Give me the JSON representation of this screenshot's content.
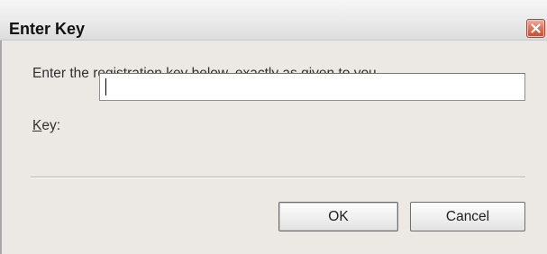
{
  "window": {
    "title": "Enter Key",
    "close_icon": "close-icon"
  },
  "dialog": {
    "prompt": "Enter the registration key below, exactly as given to you.",
    "key_label_mnemonic": "K",
    "key_label_rest": "ey:",
    "key_value": ""
  },
  "buttons": {
    "ok_label": "OK",
    "cancel_label": "Cancel"
  },
  "colors": {
    "close_button": "#d85a40",
    "dialog_background": "#ece9e4"
  }
}
